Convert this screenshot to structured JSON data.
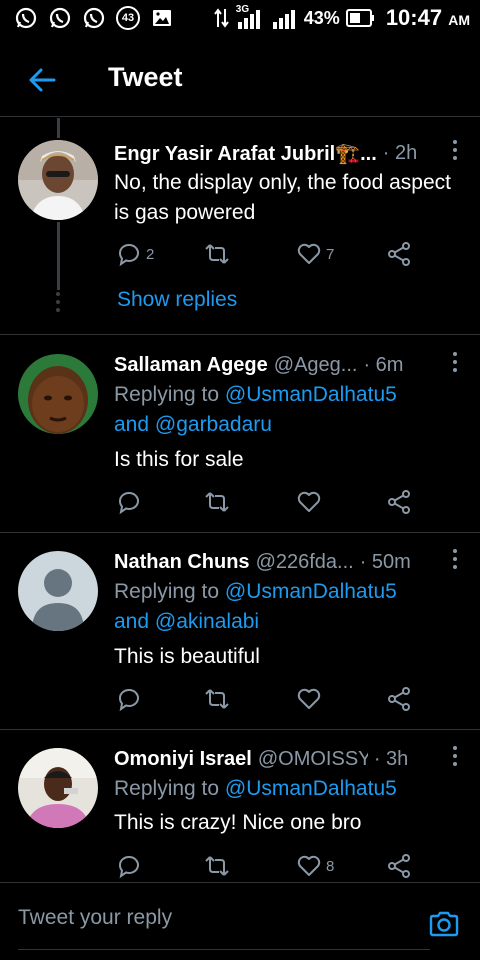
{
  "status_bar": {
    "notification_count": "43",
    "network_type": "3G",
    "battery_percent": "43%",
    "time": "10:47",
    "ampm": "AM",
    "icons": [
      "whatsapp-icon",
      "whatsapp-icon",
      "whatsapp-icon",
      "notification-count-icon",
      "gallery-icon",
      "data-arrows-icon",
      "signal-icon",
      "signal-icon",
      "battery-icon"
    ]
  },
  "header": {
    "title": "Tweet",
    "back_icon": "back-arrow-icon"
  },
  "colors": {
    "background": "#000000",
    "accent": "#1d9bf0",
    "muted": "#8b98a5",
    "divider": "#2f3336"
  },
  "tweets": [
    {
      "name": "Engr Yasir Arafat Jubril🏗️...",
      "handle": "",
      "time": "· 2h",
      "body_lines": [
        "No, the display only, the food aspect",
        "is gas powered"
      ],
      "reply_count": "2",
      "retweet_count": "",
      "like_count": "7",
      "show_replies": "Show replies"
    },
    {
      "name": "Sallaman Agege",
      "handle": "@Ageg...",
      "time": "· 6m",
      "replying_prefix": "Replying to",
      "replying_to_1": "@UsmanDalhatu5",
      "and": "and",
      "replying_to_2": "@garbadaru",
      "body": "Is this for sale",
      "like_count": ""
    },
    {
      "name": "Nathan Chuns",
      "handle": "@226fda...",
      "time": "· 50m",
      "replying_prefix": "Replying to",
      "replying_to_1": "@UsmanDalhatu5",
      "and": "and",
      "replying_to_2": "@akinalabi",
      "body": "This is beautiful",
      "like_count": ""
    },
    {
      "name": "Omoniyi Israel",
      "handle": "@OMOISSY",
      "time": "· 3h",
      "replying_prefix": "Replying to",
      "replying_to_1": "@UsmanDalhatu5",
      "body": "This is crazy! Nice one bro",
      "like_count": "8"
    }
  ],
  "reply_bar": {
    "placeholder": "Tweet your reply",
    "camera_icon": "camera-icon"
  }
}
